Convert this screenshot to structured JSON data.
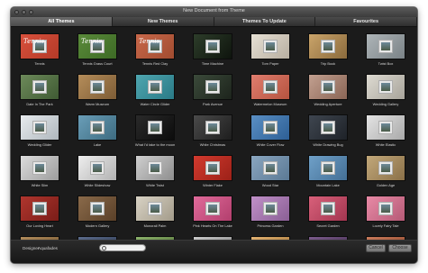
{
  "window": {
    "title": "New Document from Theme"
  },
  "tabs": [
    {
      "label": "All Themes",
      "active": true
    },
    {
      "label": "New Themes",
      "active": false
    },
    {
      "label": "Themes To Update",
      "active": false
    },
    {
      "label": "Favourites",
      "active": false
    }
  ],
  "themes": [
    {
      "label": "Tennis",
      "color1": "#d9503c",
      "color2": "#b33a28",
      "thumb_text": "Tennis"
    },
    {
      "label": "Tennis Grass Court",
      "color1": "#5a8a3a",
      "color2": "#3d6a25",
      "thumb_text": "Tennis"
    },
    {
      "label": "Tennis Red Clay",
      "color1": "#c8684a",
      "color2": "#a14c30",
      "thumb_text": "Tennis"
    },
    {
      "label": "Time Machine",
      "color1": "#2d3d2a",
      "color2": "#0e140d",
      "thumb_text": ""
    },
    {
      "label": "Torn Paper",
      "color1": "#e6e0d4",
      "color2": "#b7aea0",
      "thumb_text": ""
    },
    {
      "label": "Trip Book",
      "color1": "#caa46a",
      "color2": "#8a6a3c",
      "thumb_text": ""
    },
    {
      "label": "Twist Box",
      "color1": "#aeb5b8",
      "color2": "#7a8286",
      "thumb_text": ""
    },
    {
      "label": "Date In The Park",
      "color1": "#6d8a5a",
      "color2": "#3f5a33",
      "thumb_text": ""
    },
    {
      "label": "Warm Museum",
      "color1": "#b58d5a",
      "color2": "#7d5c35",
      "thumb_text": ""
    },
    {
      "label": "Water Circle Glider",
      "color1": "#4fa6b0",
      "color2": "#2a7a86",
      "thumb_text": ""
    },
    {
      "label": "Park Avenue",
      "color1": "#3b4a3a",
      "color2": "#1d241c",
      "thumb_text": ""
    },
    {
      "label": "Watermelon Museum",
      "color1": "#e07d6e",
      "color2": "#b5533f",
      "thumb_text": ""
    },
    {
      "label": "Wedding Aperture",
      "color1": "#c2a090",
      "color2": "#8a6555",
      "thumb_text": ""
    },
    {
      "label": "Wedding Gallery",
      "color1": "#dedbd2",
      "color2": "#a7a39a",
      "thumb_text": ""
    },
    {
      "label": "Wedding Glider",
      "color1": "#e8ecef",
      "color2": "#aeb6bc",
      "thumb_text": ""
    },
    {
      "label": "Lake",
      "color1": "#6a9eb8",
      "color2": "#3d6b80",
      "thumb_text": ""
    },
    {
      "label": "What I'd take to the moon",
      "color1": "#2a2a2a",
      "color2": "#0c0c0c",
      "thumb_text": ""
    },
    {
      "label": "White Christmas",
      "color1": "#4a4a4a",
      "color2": "#1e1e1e",
      "thumb_text": ""
    },
    {
      "label": "White Cover Flow",
      "color1": "#5a8fc4",
      "color2": "#2d5f95",
      "thumb_text": ""
    },
    {
      "label": "White Drawing Bug",
      "color1": "#3f4650",
      "color2": "#1e2228",
      "thumb_text": ""
    },
    {
      "label": "White Elastic",
      "color1": "#e4e4e4",
      "color2": "#a9a9a9",
      "thumb_text": ""
    },
    {
      "label": "White Slim",
      "color1": "#dcdcdc",
      "color2": "#9c9c9c",
      "thumb_text": ""
    },
    {
      "label": "White Slideshow",
      "color1": "#eeeeee",
      "color2": "#b2b2b2",
      "thumb_text": ""
    },
    {
      "label": "White Twist",
      "color1": "#cfcfcf",
      "color2": "#8e8e8e",
      "thumb_text": ""
    },
    {
      "label": "Winter Flake",
      "color1": "#d23a2e",
      "color2": "#9c2118",
      "thumb_text": ""
    },
    {
      "label": "Wood Star",
      "color1": "#8aa6c0",
      "color2": "#5b7994",
      "thumb_text": ""
    },
    {
      "label": "Mountain Lake",
      "color1": "#6fa0c8",
      "color2": "#446f95",
      "thumb_text": ""
    },
    {
      "label": "Golden Age",
      "color1": "#c2a87a",
      "color2": "#8a7048",
      "thumb_text": ""
    },
    {
      "label": "Our Loving Heart",
      "color1": "#b0362e",
      "color2": "#7a1d18",
      "thumb_text": ""
    },
    {
      "label": "Modern Gallery",
      "color1": "#8a6a4a",
      "color2": "#5a4028",
      "thumb_text": ""
    },
    {
      "label": "Monorail Palm",
      "color1": "#d8d2c4",
      "color2": "#a39b8a",
      "thumb_text": ""
    },
    {
      "label": "Pink Hearts On The Lake",
      "color1": "#e06a9a",
      "color2": "#b23f6d",
      "thumb_text": ""
    },
    {
      "label": "Princess Garden",
      "color1": "#c090c8",
      "color2": "#8a5f95",
      "thumb_text": ""
    },
    {
      "label": "Secret Garden",
      "color1": "#d8607a",
      "color2": "#a33650",
      "thumb_text": ""
    },
    {
      "label": "Lovely Fairy Tale",
      "color1": "#e88aa6",
      "color2": "#b55a76",
      "thumb_text": ""
    },
    {
      "label": "",
      "color1": "#b08a5a",
      "color2": "#7a5c35",
      "thumb_text": ""
    },
    {
      "label": "",
      "color1": "#5a6a8a",
      "color2": "#33405a",
      "thumb_text": ""
    },
    {
      "label": "",
      "color1": "#8ab06a",
      "color2": "#5a7a3c",
      "thumb_text": ""
    },
    {
      "label": "",
      "color1": "#c8c8c8",
      "color2": "#8a8a8a",
      "thumb_text": ""
    },
    {
      "label": "",
      "color1": "#e0b070",
      "color2": "#a87a3c",
      "thumb_text": ""
    },
    {
      "label": "",
      "color1": "#7a5a8a",
      "color2": "#4a3358",
      "thumb_text": ""
    },
    {
      "label": "",
      "color1": "#c87a5a",
      "color2": "#944c30",
      "thumb_text": ""
    }
  ],
  "bottom": {
    "designer_label": "Designer",
    "designer_value": "Aquafades",
    "search_placeholder": "",
    "cancel_label": "Cancel",
    "choose_label": "Choose"
  }
}
